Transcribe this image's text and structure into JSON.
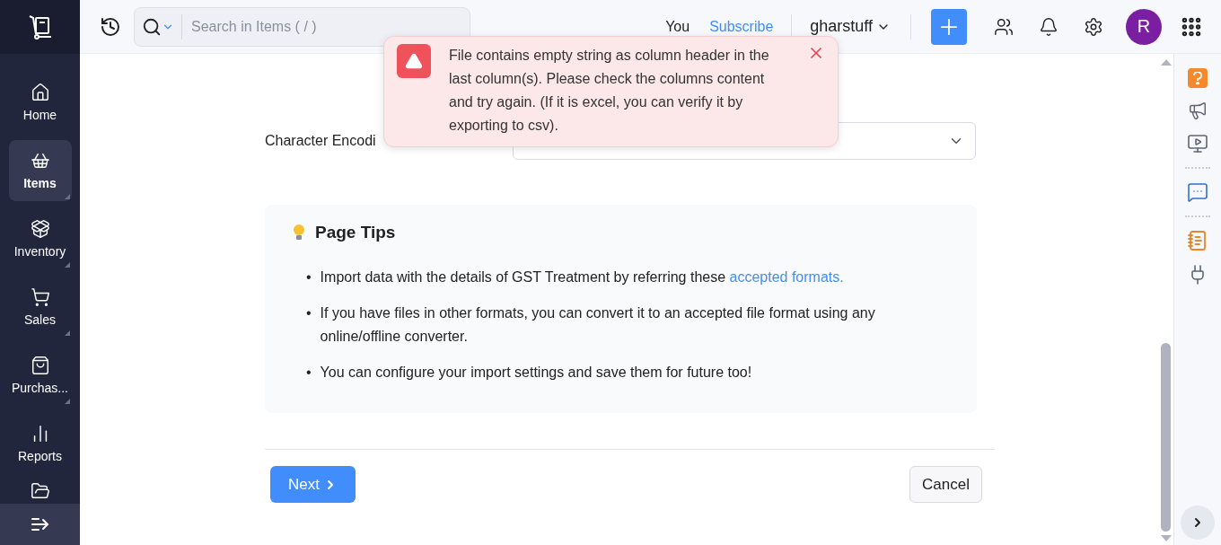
{
  "sidebar": {
    "items": [
      {
        "label": "Home",
        "selected": false,
        "has_submenu": false
      },
      {
        "label": "Items",
        "selected": true,
        "has_submenu": true
      },
      {
        "label": "Inventory",
        "selected": false,
        "has_submenu": true
      },
      {
        "label": "Sales",
        "selected": false,
        "has_submenu": true
      },
      {
        "label": "Purchas...",
        "selected": false,
        "has_submenu": true
      },
      {
        "label": "Reports",
        "selected": false,
        "has_submenu": false
      }
    ]
  },
  "header": {
    "search": {
      "placeholder": "Search in Items ( / )"
    },
    "you": "You",
    "subscribe": "Subscribe",
    "organization": "gharstuff",
    "avatar": "R"
  },
  "toast": {
    "message": "File contains empty string as column header in the last column(s). Please check the columns content and try again. (If it is excel, you can verify it by exporting to csv)."
  },
  "form": {
    "encoding_label": "Character Encodi"
  },
  "tips": {
    "title": "Page Tips",
    "items": [
      {
        "bullet": "•",
        "text": "Import data with the details of GST Treatment by referring these ",
        "link": "accepted formats."
      },
      {
        "bullet": "•",
        "text": "If you have files in other formats, you can convert it to an accepted file format using any online/offline converter."
      },
      {
        "bullet": "•",
        "text": "You can configure your import settings and save them for future too!"
      }
    ]
  },
  "buttons": {
    "next": "Next",
    "cancel": "Cancel"
  }
}
